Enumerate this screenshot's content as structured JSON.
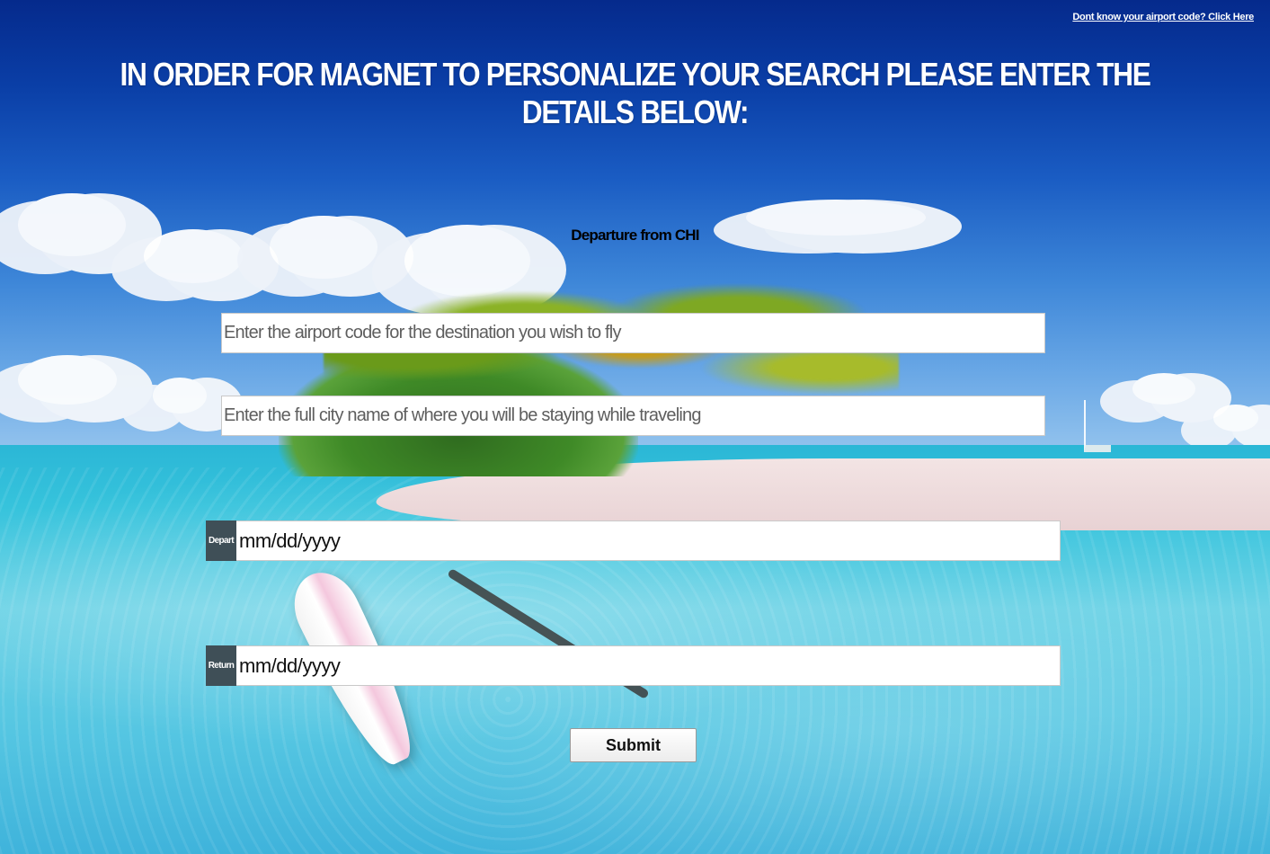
{
  "header": {
    "help_link": "Dont know your airport code? Click Here",
    "title": "IN ORDER FOR MAGNET TO PERSONALIZE YOUR SEARCH PLEASE ENTER THE DETAILS BELOW:"
  },
  "form": {
    "departure_text": "Departure from CHI",
    "destination_code": {
      "placeholder": "Enter the airport code for the destination you wish to fly",
      "value": ""
    },
    "city_name": {
      "placeholder": "Enter the full city name of where you will be staying while traveling",
      "value": ""
    },
    "depart": {
      "label": "Depart",
      "value": "mm/dd/yyyy"
    },
    "return": {
      "label": "Return",
      "value": "mm/dd/yyyy"
    },
    "submit_label": "Submit"
  },
  "colors": {
    "title_text": "#ffffff",
    "date_label_bg": "#3f4f57",
    "input_bg": "#ffffff"
  },
  "icons": {
    "background": "tropical-island-background-image"
  }
}
